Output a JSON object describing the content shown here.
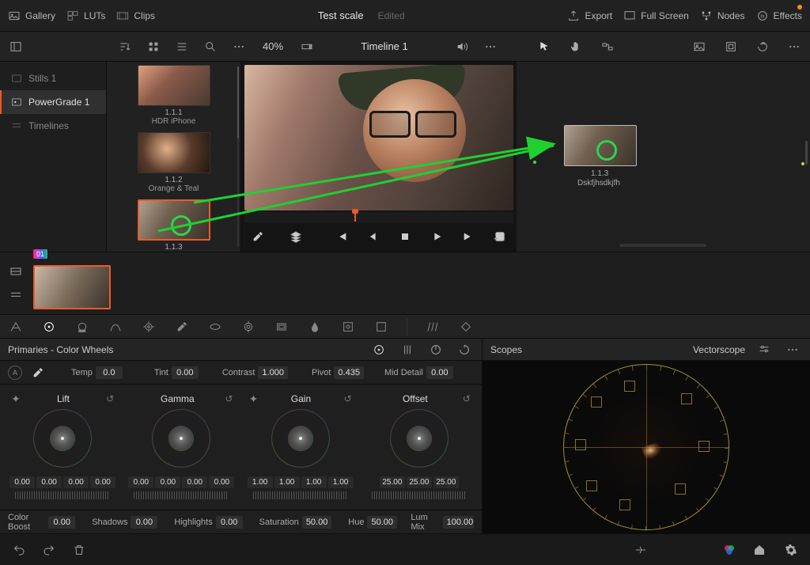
{
  "topbar": {
    "gallery": "Gallery",
    "luts": "LUTs",
    "clips": "Clips",
    "project_title": "Test scale",
    "project_status": "Edited",
    "export": "Export",
    "fullscreen": "Full Screen",
    "nodes": "Nodes",
    "effects": "Effects"
  },
  "toolbar": {
    "zoom": "40%",
    "timeline_name": "Timeline 1"
  },
  "sidebar": {
    "stills": "Stills 1",
    "powergrade": "PowerGrade 1",
    "timelines": "Timelines"
  },
  "gallery_items": [
    {
      "id": "1.1.1",
      "name": "HDR iPhone"
    },
    {
      "id": "1.1.2",
      "name": "Orange & Teal"
    },
    {
      "id": "1.1.3",
      "name": "Dskfjhsdkjfh"
    }
  ],
  "node": {
    "id": "1.1.3",
    "name": "Dskfjhsdkjfh"
  },
  "clip_badge": "01",
  "primaries": {
    "title": "Primaries - Color Wheels",
    "temp": {
      "label": "Temp",
      "value": "0.0"
    },
    "tint": {
      "label": "Tint",
      "value": "0.00"
    },
    "contrast": {
      "label": "Contrast",
      "value": "1.000"
    },
    "pivot": {
      "label": "Pivot",
      "value": "0.435"
    },
    "middetail": {
      "label": "Mid Detail",
      "value": "0.00"
    },
    "wheels": [
      {
        "name": "Lift",
        "vals": [
          "0.00",
          "0.00",
          "0.00",
          "0.00"
        ]
      },
      {
        "name": "Gamma",
        "vals": [
          "0.00",
          "0.00",
          "0.00",
          "0.00"
        ]
      },
      {
        "name": "Gain",
        "vals": [
          "1.00",
          "1.00",
          "1.00",
          "1.00"
        ]
      },
      {
        "name": "Offset",
        "vals": [
          "25.00",
          "25.00",
          "25.00"
        ]
      }
    ],
    "colorboost": {
      "label": "Color Boost",
      "value": "0.00"
    },
    "shadows": {
      "label": "Shadows",
      "value": "0.00"
    },
    "highlights": {
      "label": "Highlights",
      "value": "0.00"
    },
    "saturation": {
      "label": "Saturation",
      "value": "50.00"
    },
    "hue": {
      "label": "Hue",
      "value": "50.00"
    },
    "lummix": {
      "label": "Lum Mix",
      "value": "100.00"
    }
  },
  "scopes": {
    "title": "Scopes",
    "mode": "Vectorscope"
  }
}
